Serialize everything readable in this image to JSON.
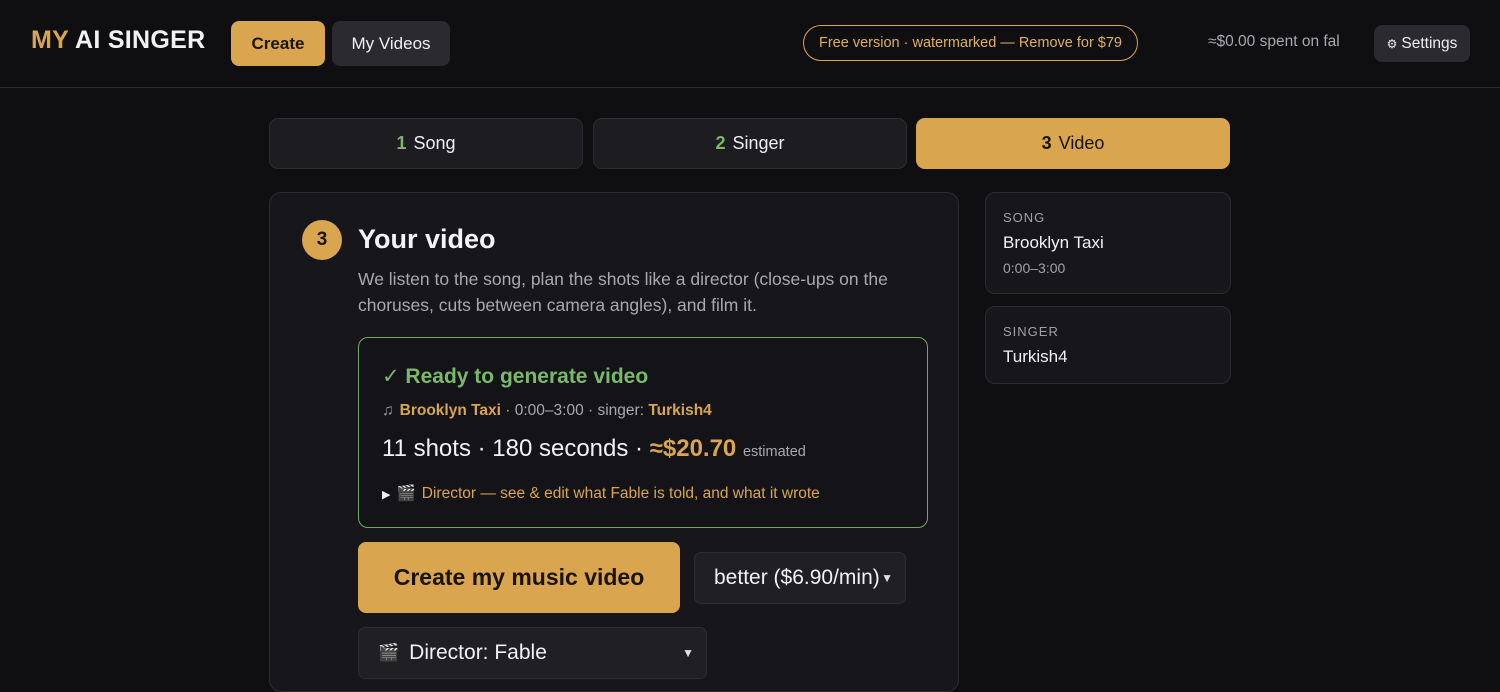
{
  "header": {
    "logo_accent": "MY",
    "logo_rest": "AI SINGER",
    "nav": {
      "create": "Create",
      "my_videos": "My Videos"
    },
    "free_notice": "Free version · watermarked — Remove for $79",
    "spent": "≈$0.00 spent on fal",
    "settings": "Settings",
    "settings_icon": "gear-icon"
  },
  "steps": [
    {
      "num": "1",
      "label": "Song",
      "active": false
    },
    {
      "num": "2",
      "label": "Singer",
      "active": false
    },
    {
      "num": "3",
      "label": "Video",
      "active": true
    }
  ],
  "main": {
    "step_number": "3",
    "title": "Your video",
    "description": "We listen to the song, plan the shots like a director (close-ups on the choruses, cuts between camera angles), and film it.",
    "ready": {
      "title": "✓ Ready to generate video",
      "song_name": "Brooklyn Taxi",
      "song_range": " · 0:00–3:00 · singer: ",
      "singer_name": "Turkish4",
      "stats": "11 shots · 180 seconds · ",
      "cost": "≈$20.70",
      "estimated": "estimated",
      "director_toggle": "Director — see & edit what Fable is told, and what it wrote"
    },
    "create_button": "Create my music video",
    "quality_select": "better ($6.90/min)",
    "director_select": "Director: Fable"
  },
  "sidebar": {
    "song": {
      "label": "SONG",
      "value": "Brooklyn Taxi",
      "range": "0:00–3:00"
    },
    "singer": {
      "label": "SINGER",
      "value": "Turkish4"
    }
  },
  "colors": {
    "accent": "#d9a54f",
    "success": "#7ab86a",
    "background": "#0f0f12",
    "card": "#17171b"
  }
}
